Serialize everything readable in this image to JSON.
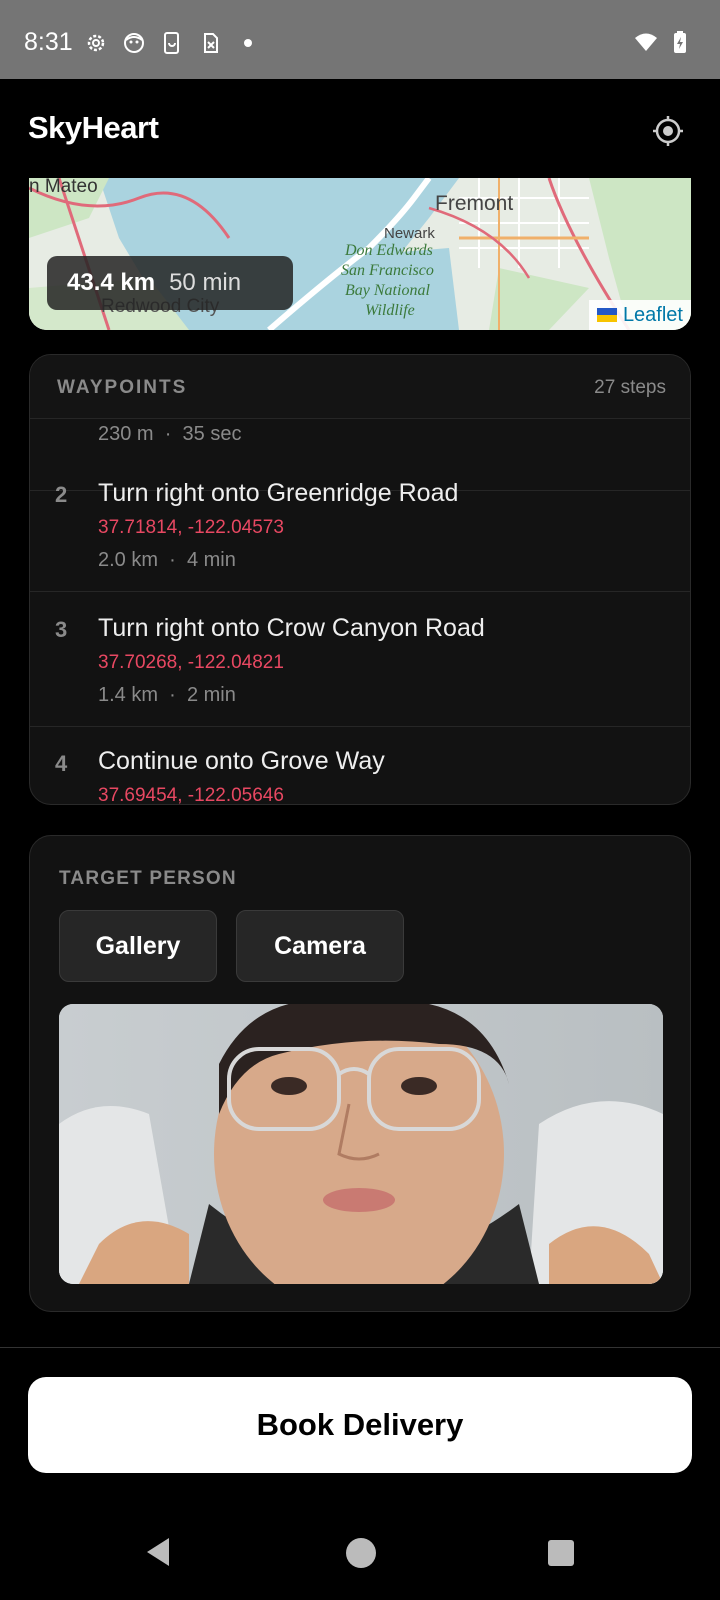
{
  "status_bar": {
    "time": "8:31",
    "left_icons": [
      "settings-icon",
      "assistant-icon",
      "screenshot-icon",
      "sim-icon",
      "dot-icon"
    ],
    "right_icons": [
      "wifi-icon",
      "battery-icon"
    ]
  },
  "app": {
    "title": "SkyHeart",
    "locate_icon": "crosshair-icon"
  },
  "map": {
    "distance": "43.4 km",
    "duration": "50 min",
    "attribution": "Leaflet",
    "labels": {
      "san_mateo": "n Mateo",
      "fremont": "Fremont",
      "newark": "Newark",
      "redwood": "Redwood City",
      "wildlife_1": "Don Edwards",
      "wildlife_2": "San Francisco",
      "wildlife_3": "Bay National",
      "wildlife_4": "Wildlife"
    }
  },
  "waypoints": {
    "title": "WAYPOINTS",
    "count": "27 steps",
    "partial_meta": {
      "distance": "230 m",
      "time": "35 sec"
    },
    "items": [
      {
        "num": "2",
        "text": "Turn right onto Greenridge Road",
        "coords": "37.71814, -122.04573",
        "distance": "2.0 km",
        "time": "4 min"
      },
      {
        "num": "3",
        "text": "Turn right onto Crow Canyon Road",
        "coords": "37.70268, -122.04821",
        "distance": "1.4 km",
        "time": "2 min"
      },
      {
        "num": "4",
        "text": "Continue onto Grove Way",
        "coords": "37.69454, -122.05646"
      }
    ],
    "separator": "·"
  },
  "target": {
    "title": "TARGET PERSON",
    "gallery_label": "Gallery",
    "camera_label": "Camera"
  },
  "book_label": "Book Delivery",
  "colors": {
    "accent_coords": "#e84862",
    "card_bg": "#121212",
    "status_bar": "#757575"
  }
}
